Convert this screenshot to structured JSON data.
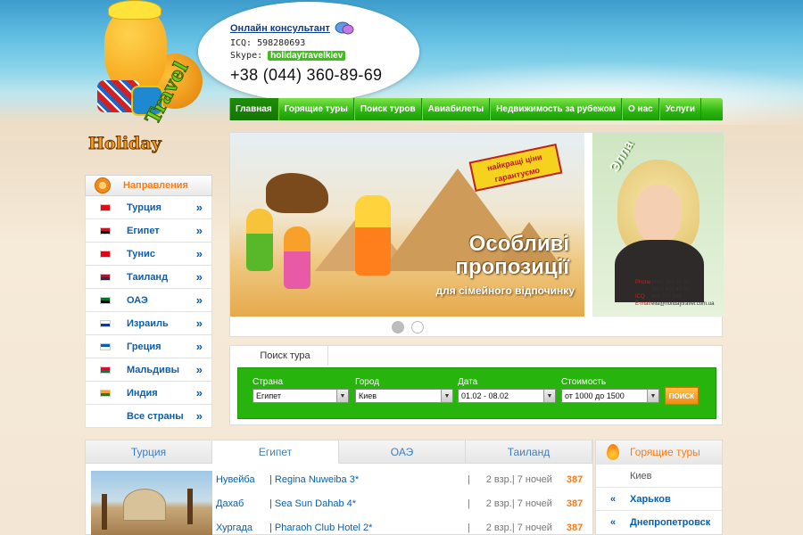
{
  "logo": {
    "word1": "Holiday",
    "word2": "Travel"
  },
  "contacts": {
    "consultant_link": "Онлайн консультант",
    "icq": "ICQ: 598280693",
    "skype_label": "Skype:",
    "skype_id": "holidaytravelkiev",
    "phone": "+38 (044) 360-89-69"
  },
  "topnav": [
    {
      "label": "Главная",
      "active": true
    },
    {
      "label": "Горящие туры"
    },
    {
      "label": "Поиск туров"
    },
    {
      "label": "Авиабилеты"
    },
    {
      "label": "Недвижимость за рубежом"
    },
    {
      "label": "О нас"
    },
    {
      "label": "Услуги"
    }
  ],
  "banner": {
    "stamp": "найкращі ціни гарантуємо",
    "title_line1": "Особливі",
    "title_line2": "пропозиції",
    "subtitle": "для сімейного відпочинку",
    "side_name": "Элла",
    "side_contacts": [
      {
        "label": "Phone",
        "value": "(044) 360 89 69"
      },
      {
        "label": "",
        "value": "(063) 420 47 87"
      },
      {
        "label": "ICQ",
        "value": "466 705 684"
      },
      {
        "label": "E-mail",
        "value": "ella@holidaytravel.com.ua"
      }
    ],
    "dots": 2,
    "active_dot": 1
  },
  "sidebar": {
    "title": "Направления",
    "items": [
      {
        "label": "Турция",
        "flag": [
          "#e30a17",
          "#e30a17"
        ]
      },
      {
        "label": "Египет",
        "flag": [
          "#ce1126",
          "#000000"
        ]
      },
      {
        "label": "Тунис",
        "flag": [
          "#e70013",
          "#e70013"
        ]
      },
      {
        "label": "Таиланд",
        "flag": [
          "#a51931",
          "#2d2a4a"
        ]
      },
      {
        "label": "ОАЭ",
        "flag": [
          "#00732f",
          "#000000"
        ]
      },
      {
        "label": "Израиль",
        "flag": [
          "#ffffff",
          "#0038b8"
        ]
      },
      {
        "label": "Греция",
        "flag": [
          "#0d5eaf",
          "#ffffff"
        ]
      },
      {
        "label": "Мальдивы",
        "flag": [
          "#d21034",
          "#007e3a"
        ]
      },
      {
        "label": "Индия",
        "flag": [
          "#ff9933",
          "#138808"
        ]
      },
      {
        "label": "Все страны",
        "flag": null
      }
    ],
    "arrow": "»"
  },
  "search": {
    "tab": "Поиск тура",
    "fields": [
      {
        "label": "Страна",
        "value": "Египет"
      },
      {
        "label": "Город",
        "value": "Киев"
      },
      {
        "label": "Дата",
        "value": "01.02 - 08.02"
      },
      {
        "label": "Стоимость",
        "value": "от 1000 до 1500"
      }
    ],
    "button": "ПОИСК"
  },
  "tours": {
    "tabs": [
      {
        "label": "Турция"
      },
      {
        "label": "Египет",
        "active": true
      },
      {
        "label": "ОАЭ"
      },
      {
        "label": "Таиланд"
      }
    ],
    "rows": [
      {
        "city": "Нувейба",
        "hotel": "Regina Nuweiba 3*",
        "info": "2 взр.| 7 ночей",
        "price": "387"
      },
      {
        "city": "Дахаб",
        "hotel": "Sea Sun Dahab 4*",
        "info": "2 взр.| 7 ночей",
        "price": "387"
      },
      {
        "city": "Хургада",
        "hotel": "Pharaoh Club Hotel 2*",
        "info": "2 взр.| 7 ночей",
        "price": "387"
      }
    ]
  },
  "hot": {
    "title": "Горящие туры",
    "items": [
      {
        "label": "Киев",
        "arrow": ""
      },
      {
        "label": "Харьков",
        "arrow": "«"
      },
      {
        "label": "Днепропетровск",
        "arrow": "«"
      }
    ]
  }
}
